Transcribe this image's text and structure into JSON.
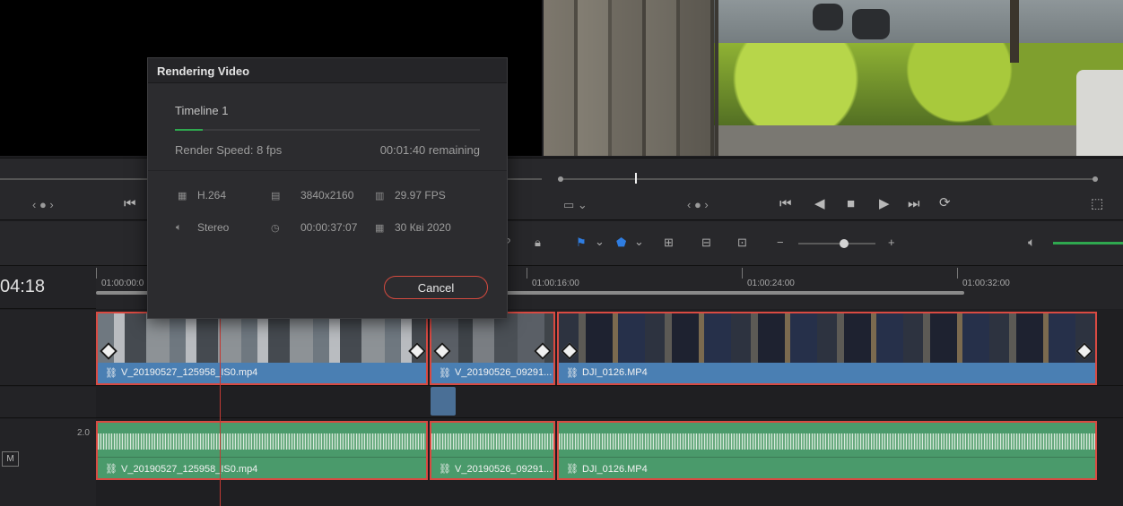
{
  "dialog": {
    "title": "Rendering Video",
    "job_name": "Timeline 1",
    "render_speed": "Render Speed: 8 fps",
    "remaining": "00:01:40 remaining",
    "progress": 0.09,
    "codec": "H.264",
    "resolution": "3840x2160",
    "framerate": "29.97 FPS",
    "audio": "Stereo",
    "duration": "00:00:37:07",
    "date": "30 Квi 2020",
    "cancel_label": "Cancel"
  },
  "timeline": {
    "timecode": "04:18",
    "ruler": [
      "01:00:00:0",
      "01:00:16:00",
      "01:00:24:00",
      "01:00:32:00"
    ],
    "audio_level": "2.0",
    "mute_label": "M",
    "video_clips": [
      "V_20190527_125958_IS0.mp4",
      "V_20190526_09291...",
      "DJI_0126.MP4"
    ],
    "audio_clips": [
      "V_20190527_125958_IS0.mp4",
      "V_20190526_09291...",
      "DJI_0126.MP4"
    ]
  },
  "colors": {
    "accent_red": "#d94a42",
    "video_clip": "#4a7fb3",
    "audio_clip": "#4a9a6b",
    "progress": "#2fa84f",
    "volume": "#2fa84f"
  }
}
